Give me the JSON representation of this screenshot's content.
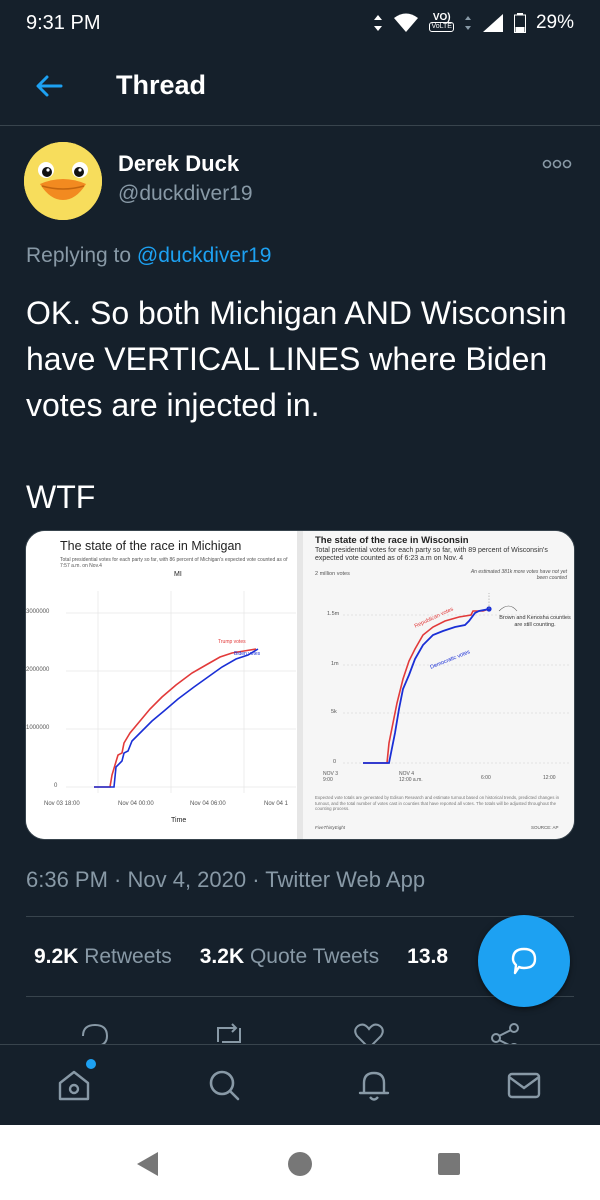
{
  "status_bar": {
    "time": "9:31 PM",
    "battery": "29%",
    "network_label": "VoLTE"
  },
  "header": {
    "title": "Thread",
    "back_icon": "arrow-left-icon"
  },
  "tweet": {
    "author_name": "Derek Duck",
    "author_handle": "@duckdiver19",
    "replying_prefix": "Replying to ",
    "replying_to": "@duckdiver19",
    "text": "OK. So both Michigan AND Wisconsin have VERTICAL LINES where Biden votes are injected in.\n\nWTF",
    "timestamp": "6:36 PM · Nov 4, 2020 · Twitter Web App",
    "stats": {
      "retweets_count": "9.2K",
      "retweets_label": "Retweets",
      "quote_count": "3.2K",
      "quote_label": "Quote Tweets",
      "likes_count": "13.8"
    }
  },
  "media": {
    "michigan": {
      "title": "The state of the race in Michigan",
      "subtitle": "Total presidential votes for each party so far, with 86 percent of Michigan's expected vote counted as of 7:57 a.m. on Nov.4",
      "state_label": "MI",
      "y_ticks": [
        "3000000",
        "2000000",
        "1000000",
        "0"
      ],
      "x_ticks": [
        "Nov 03 18:00",
        "Nov 04 00:00",
        "Nov 04 06:00",
        "Nov 04 1"
      ],
      "x_label": "Time",
      "series_trump": "Trump votes",
      "series_biden": "Biden votes"
    },
    "wisconsin": {
      "title": "The state of the race in Wisconsin",
      "subtitle": "Total presidential votes for each party so far, with 89 percent of Wisconsin's expected vote counted as of 6:23 a.m on Nov. 4",
      "top_label": "2 million votes",
      "note_more": "An estimated 381k more votes have not yet been counted",
      "y_ticks": [
        "1.5m",
        "1m",
        "5k",
        "0"
      ],
      "x_ticks": [
        "NOV 3\n9:00",
        "NOV 4\n12:00 a.m.",
        "6:00",
        "12:00"
      ],
      "series_rep": "Republican votes",
      "series_dem": "Democratic votes",
      "callout": "Brown and Kenosha counties are still counting.",
      "footnote": "Expected vote totals are generated by Edison Research and estimate turnout based on historical trends, predicted changes in turnout, and the total number of votes cast in counties that have reported all votes. The totals will be adjusted throughout the counting process.",
      "source_left": "FiveThirtyEight",
      "source_right": "SOURCE: AP"
    }
  },
  "colors": {
    "background": "#15202b",
    "accent": "#1da1f2",
    "muted": "#8899a6",
    "divider": "#38444d",
    "republican": "#e23a3a",
    "democrat": "#1a2fd6"
  }
}
